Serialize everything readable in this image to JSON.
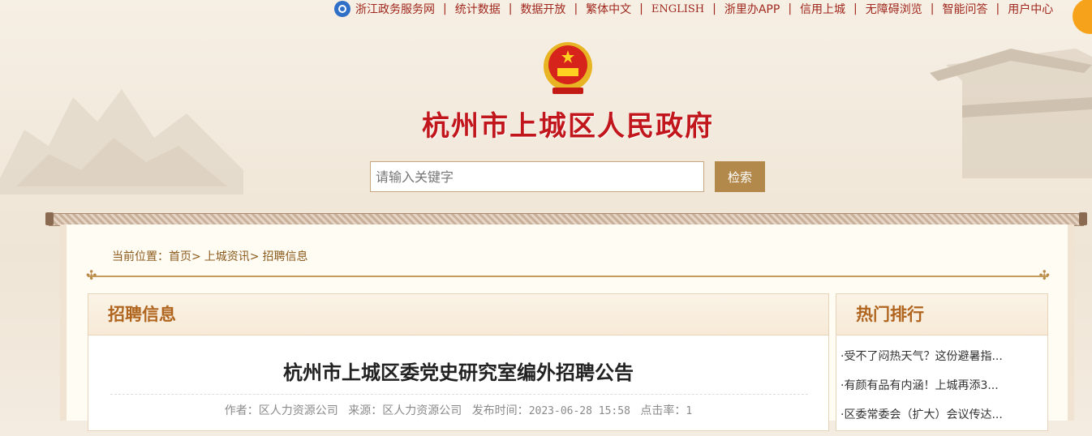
{
  "topnav": {
    "items": [
      "浙江政务服务网",
      "统计数据",
      "数据开放",
      "繁体中文",
      "ENGLISH",
      "浙里办APP",
      "信用上城",
      "无障碍浏览",
      "智能问答",
      "用户中心"
    ]
  },
  "header": {
    "site_title": "杭州市上城区人民政府"
  },
  "search": {
    "placeholder": "请输入关键字",
    "button_label": "检索"
  },
  "breadcrumb": {
    "prefix": "当前位置：",
    "items": [
      "首页>",
      "上城资讯>",
      "招聘信息"
    ]
  },
  "main": {
    "section_title": "招聘信息",
    "article_title": "杭州市上城区委党史研究室编外招聘公告",
    "meta": {
      "author_label": "作者：",
      "author": "区人力资源公司",
      "source_label": "来源：",
      "source": "区人力资源公司",
      "time_label": "发布时间：",
      "time": "2023-06-28 15:58",
      "clicks_label": "点击率：",
      "clicks": "1"
    }
  },
  "sidebar": {
    "title": "热门排行",
    "items": [
      "·受不了闷热天气？这份避暑指...",
      "·有颜有品有内涵！上城再添3...",
      "·区委常委会（扩大）会议传达..."
    ]
  },
  "colors": {
    "accent_red": "#c2161d",
    "brown_button": "#b3894b",
    "section_orange": "#b0651f"
  }
}
